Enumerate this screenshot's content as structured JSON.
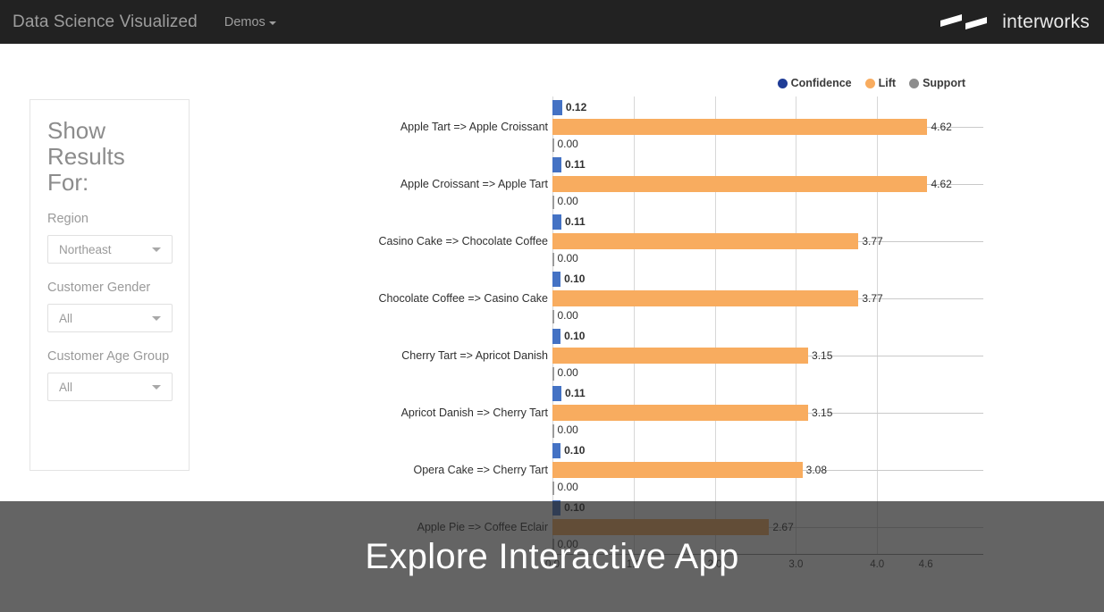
{
  "header": {
    "brand_title": "Data Science Visualized",
    "nav_items": [
      {
        "label": "Demos",
        "has_caret": true
      }
    ],
    "logo_text": "interworks",
    "logo_icon": "interworks-parallelogram-mark",
    "background_color": "#222222"
  },
  "sidebar": {
    "panel_title": "Show Results For:",
    "filters": [
      {
        "label": "Region",
        "value": "Northeast",
        "icon": "chevron-down-icon"
      },
      {
        "label": "Customer Gender",
        "value": "All",
        "icon": "chevron-down-icon"
      },
      {
        "label": "Customer Age Group",
        "value": "All",
        "icon": "chevron-down-icon"
      }
    ]
  },
  "overlay": {
    "cta_label": "Explore Interactive App",
    "background_color": "rgba(40,40,40,0.72)"
  },
  "chart_data": {
    "type": "bar",
    "orientation": "horizontal",
    "title": "",
    "xlabel": "",
    "ylabel": "",
    "xlim": [
      0,
      4.62
    ],
    "grid": true,
    "legend_position": "top-right",
    "tick_labels": [
      "0.0",
      "1.0",
      "2.0",
      "3.0",
      "4.0",
      "4.6"
    ],
    "tick_values": [
      0.0,
      1.0,
      2.0,
      3.0,
      4.0,
      4.6
    ],
    "legend": [
      {
        "name": "Confidence",
        "color": "#1f3c96"
      },
      {
        "name": "Lift",
        "color": "#f8ac5f"
      },
      {
        "name": "Support",
        "color": "#8d8d8d"
      }
    ],
    "categories": [
      "Apple Tart => Apple Croissant",
      "Apple Croissant => Apple Tart",
      "Casino Cake => Chocolate Coffee",
      "Chocolate Coffee => Casino Cake",
      "Cherry Tart => Apricot Danish",
      "Apricot Danish => Cherry Tart",
      "Opera Cake => Cherry Tart",
      "Apple Pie => Coffee Eclair"
    ],
    "series": [
      {
        "name": "Confidence",
        "color": "#4472c4",
        "values": [
          0.12,
          0.11,
          0.11,
          0.1,
          0.1,
          0.11,
          0.1,
          0.1
        ],
        "labels": [
          "0.12",
          "0.11",
          "0.11",
          "0.10",
          "0.10",
          "0.11",
          "0.10",
          "0.10"
        ]
      },
      {
        "name": "Lift",
        "color": "#f8ac5f",
        "values": [
          4.62,
          4.62,
          3.77,
          3.77,
          3.15,
          3.15,
          3.08,
          2.67
        ],
        "labels": [
          "4.62",
          "4.62",
          "3.77",
          "3.77",
          "3.15",
          "3.15",
          "3.08",
          "2.67"
        ]
      },
      {
        "name": "Support",
        "color": "#9b9b9b",
        "values": [
          0.0,
          0.0,
          0.0,
          0.0,
          0.0,
          0.0,
          0.0,
          0.0
        ],
        "labels": [
          "0.00",
          "0.00",
          "0.00",
          "0.00",
          "0.00",
          "0.00",
          "0.00",
          "0.00"
        ]
      }
    ]
  }
}
